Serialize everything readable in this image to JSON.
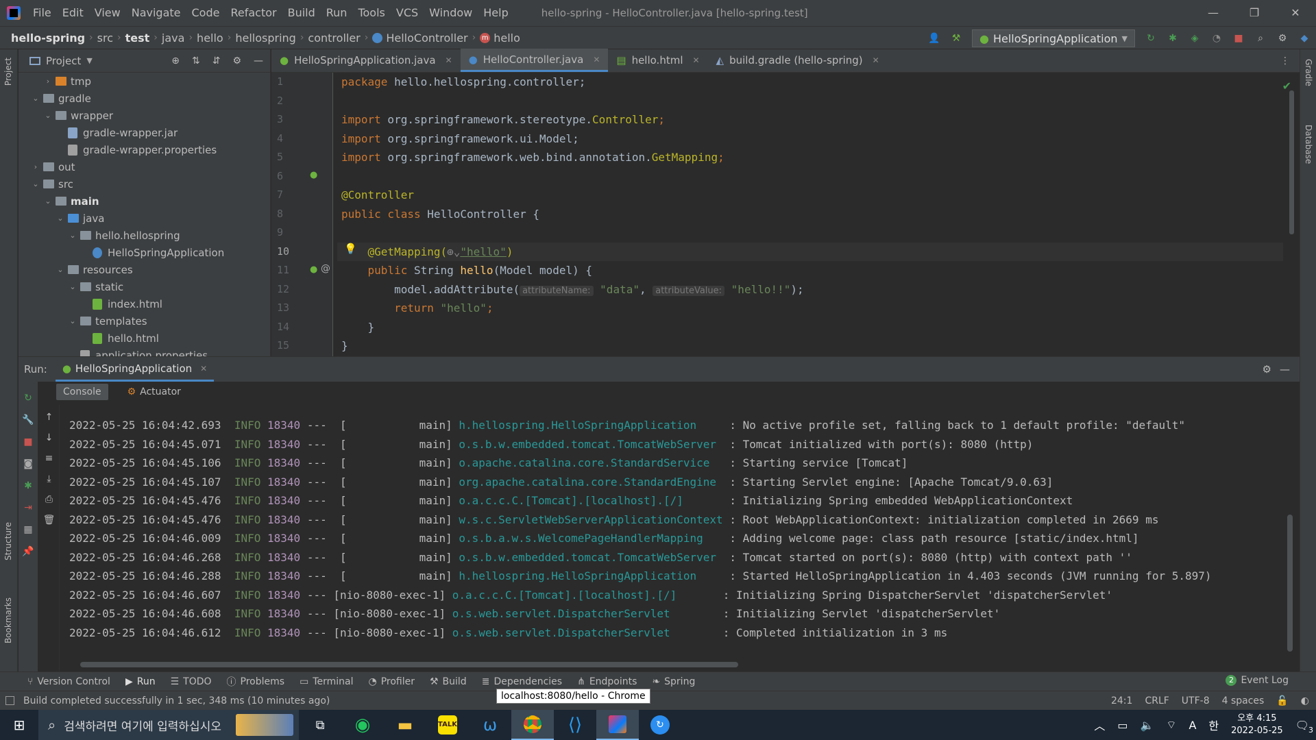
{
  "menubar": {
    "items": [
      "File",
      "Edit",
      "View",
      "Navigate",
      "Code",
      "Refactor",
      "Build",
      "Run",
      "Tools",
      "VCS",
      "Window",
      "Help"
    ],
    "window_title": "hello-spring - HelloController.java [hello-spring.test]"
  },
  "breadcrumb": {
    "items": [
      "hello-spring",
      "src",
      "test",
      "java",
      "hello",
      "hellospring",
      "controller",
      "HelloController",
      "hello"
    ]
  },
  "run_config": "HelloSpringApplication",
  "project": {
    "title": "Project",
    "tree": [
      {
        "label": "tmp",
        "depth": 2,
        "arrow": "right",
        "icon": "folder-orange"
      },
      {
        "label": "gradle",
        "depth": 1,
        "arrow": "down",
        "icon": "folder"
      },
      {
        "label": "wrapper",
        "depth": 2,
        "arrow": "down",
        "icon": "folder"
      },
      {
        "label": "gradle-wrapper.jar",
        "depth": 3,
        "arrow": "",
        "icon": "jar"
      },
      {
        "label": "gradle-wrapper.properties",
        "depth": 3,
        "arrow": "",
        "icon": "props"
      },
      {
        "label": "out",
        "depth": 1,
        "arrow": "right",
        "icon": "folder"
      },
      {
        "label": "src",
        "depth": 1,
        "arrow": "down",
        "icon": "folder"
      },
      {
        "label": "main",
        "depth": 2,
        "arrow": "down",
        "icon": "folder",
        "bold": true
      },
      {
        "label": "java",
        "depth": 3,
        "arrow": "down",
        "icon": "folder-blue"
      },
      {
        "label": "hello.hellospring",
        "depth": 4,
        "arrow": "down",
        "icon": "folder"
      },
      {
        "label": "HelloSpringApplication",
        "depth": 5,
        "arrow": "",
        "icon": "spring"
      },
      {
        "label": "resources",
        "depth": 3,
        "arrow": "down",
        "icon": "folder"
      },
      {
        "label": "static",
        "depth": 4,
        "arrow": "down",
        "icon": "folder"
      },
      {
        "label": "index.html",
        "depth": 5,
        "arrow": "",
        "icon": "html"
      },
      {
        "label": "templates",
        "depth": 4,
        "arrow": "down",
        "icon": "folder"
      },
      {
        "label": "hello.html",
        "depth": 5,
        "arrow": "",
        "icon": "html"
      },
      {
        "label": "application.properties",
        "depth": 4,
        "arrow": "",
        "icon": "props"
      }
    ]
  },
  "tabs": [
    {
      "label": "HelloSpringApplication.java",
      "active": false
    },
    {
      "label": "HelloController.java",
      "active": true
    },
    {
      "label": "hello.html",
      "active": false
    },
    {
      "label": "build.gradle (hello-spring)",
      "active": false
    }
  ],
  "code": {
    "line_numbers": [
      "1",
      "2",
      "3",
      "4",
      "5",
      "6",
      "7",
      "8",
      "9",
      "10",
      "11",
      "12",
      "13",
      "14",
      "15"
    ],
    "l1a": "package",
    "l1b": " hello.hellospring.controller;",
    "l3a": "import",
    "l3b": " org.springframework.stereotype.",
    "l3c": "Controller",
    "l4a": "import",
    "l4b": " org.springframework.ui.Model;",
    "l5a": "import",
    "l5b": " org.springframework.web.bind.annotation.",
    "l5c": "GetMapping",
    "l7": "@Controller",
    "l8a": "public class",
    "l8b": " HelloController {",
    "l10a": "@GetMapping(",
    "l10b": "\"hello\"",
    "l10c": ")",
    "l11a": "public",
    "l11b": " String ",
    "l11c": "hello",
    "l11d": "(Model model) {",
    "l12a": "model.addAttribute(",
    "l12h1": "attributeName:",
    "l12s1": "\"data\"",
    "l12h2": "attributeValue:",
    "l12s2": "\"hello!!\"",
    "l12e": ");",
    "l13a": "return",
    "l13b": "\"hello\"",
    "l14": "}",
    "l15": "}"
  },
  "run": {
    "label": "Run:",
    "config": "HelloSpringApplication",
    "tabs": [
      "Console",
      "Actuator"
    ]
  },
  "console": [
    {
      "ts": "2022-05-25 16:04:42.693",
      "lvl": "INFO",
      "pid": "18340",
      "thr": "---  [           main]",
      "cls": "h.hellospring.HelloSpringApplication    ",
      "msg": " : No active profile set, falling back to 1 default profile: \"default\""
    },
    {
      "ts": "2022-05-25 16:04:45.071",
      "lvl": "INFO",
      "pid": "18340",
      "thr": "---  [           main]",
      "cls": "o.s.b.w.embedded.tomcat.TomcatWebServer ",
      "msg": " : Tomcat initialized with port(s): 8080 (http)"
    },
    {
      "ts": "2022-05-25 16:04:45.106",
      "lvl": "INFO",
      "pid": "18340",
      "thr": "---  [           main]",
      "cls": "o.apache.catalina.core.StandardService  ",
      "msg": " : Starting service [Tomcat]"
    },
    {
      "ts": "2022-05-25 16:04:45.107",
      "lvl": "INFO",
      "pid": "18340",
      "thr": "---  [           main]",
      "cls": "org.apache.catalina.core.StandardEngine ",
      "msg": " : Starting Servlet engine: [Apache Tomcat/9.0.63]"
    },
    {
      "ts": "2022-05-25 16:04:45.476",
      "lvl": "INFO",
      "pid": "18340",
      "thr": "---  [           main]",
      "cls": "o.a.c.c.C.[Tomcat].[localhost].[/]      ",
      "msg": " : Initializing Spring embedded WebApplicationContext"
    },
    {
      "ts": "2022-05-25 16:04:45.476",
      "lvl": "INFO",
      "pid": "18340",
      "thr": "---  [           main]",
      "cls": "w.s.c.ServletWebServerApplicationContext",
      "msg": " : Root WebApplicationContext: initialization completed in 2669 ms"
    },
    {
      "ts": "2022-05-25 16:04:46.009",
      "lvl": "INFO",
      "pid": "18340",
      "thr": "---  [           main]",
      "cls": "o.s.b.a.w.s.WelcomePageHandlerMapping   ",
      "msg": " : Adding welcome page: class path resource [static/index.html]"
    },
    {
      "ts": "2022-05-25 16:04:46.268",
      "lvl": "INFO",
      "pid": "18340",
      "thr": "---  [           main]",
      "cls": "o.s.b.w.embedded.tomcat.TomcatWebServer ",
      "msg": " : Tomcat started on port(s): 8080 (http) with context path ''"
    },
    {
      "ts": "2022-05-25 16:04:46.288",
      "lvl": "INFO",
      "pid": "18340",
      "thr": "---  [           main]",
      "cls": "h.hellospring.HelloSpringApplication    ",
      "msg": " : Started HelloSpringApplication in 4.403 seconds (JVM running for 5.897)"
    },
    {
      "ts": "2022-05-25 16:04:46.607",
      "lvl": "INFO",
      "pid": "18340",
      "thr": "--- [nio-8080-exec-1]",
      "cls": "o.a.c.c.C.[Tomcat].[localhost].[/]      ",
      "msg": " : Initializing Spring DispatcherServlet 'dispatcherServlet'"
    },
    {
      "ts": "2022-05-25 16:04:46.608",
      "lvl": "INFO",
      "pid": "18340",
      "thr": "--- [nio-8080-exec-1]",
      "cls": "o.s.web.servlet.DispatcherServlet       ",
      "msg": " : Initializing Servlet 'dispatcherServlet'"
    },
    {
      "ts": "2022-05-25 16:04:46.612",
      "lvl": "INFO",
      "pid": "18340",
      "thr": "--- [nio-8080-exec-1]",
      "cls": "o.s.web.servlet.DispatcherServlet       ",
      "msg": " : Completed initialization in 3 ms"
    }
  ],
  "tool_tabs": [
    "Version Control",
    "Run",
    "TODO",
    "Problems",
    "Terminal",
    "Profiler",
    "Build",
    "Dependencies",
    "Endpoints",
    "Spring"
  ],
  "event_log": {
    "count": "2",
    "label": "Event Log"
  },
  "status": {
    "message": "Build completed successfully in 1 sec, 348 ms (10 minutes ago)",
    "tooltip": "localhost:8080/hello - Chrome",
    "position": "24:1",
    "line_sep": "CRLF",
    "encoding": "UTF-8",
    "indent": "4 spaces"
  },
  "side_tabs": {
    "project": "Project",
    "structure": "Structure",
    "bookmarks": "Bookmarks",
    "gradle": "Gradle",
    "database": "Database"
  },
  "taskbar": {
    "search_placeholder": "검색하려면 여기에 입력하십시오",
    "ime": "A",
    "ime2": "한",
    "time": "오후 4:15",
    "date": "2022-05-25",
    "notif_count": "3"
  },
  "colors": {
    "accent": "#4a88c7",
    "spring": "#6db33f",
    "run": "#499c54",
    "stop": "#c75450"
  }
}
